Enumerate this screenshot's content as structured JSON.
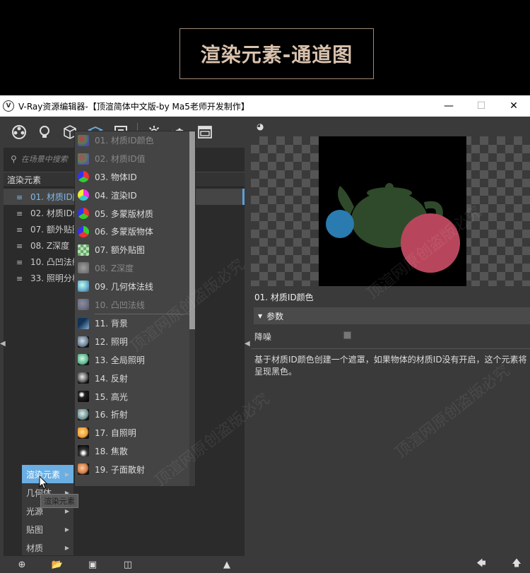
{
  "banner": {
    "title": "渲染元素-通道图"
  },
  "window": {
    "title": "V-Ray资源编辑器-【顶渲简体中文版-by Ma5老师开发制作】"
  },
  "search": {
    "placeholder": "在场景中搜索"
  },
  "tree": {
    "header": "渲染元素",
    "items": [
      {
        "label": "01. 材质ID颜色",
        "selected": true
      },
      {
        "label": "02. 材质ID值"
      },
      {
        "label": "07. 额外贴图"
      },
      {
        "label": "08. Z深度"
      },
      {
        "label": "10. 凸凹法线"
      },
      {
        "label": "33. 照明分析"
      }
    ]
  },
  "context_menu": {
    "items": [
      {
        "label": "渲染元素",
        "active": true
      },
      {
        "label": "几何体"
      },
      {
        "label": "光源"
      },
      {
        "label": "贴图"
      },
      {
        "label": "材质"
      }
    ],
    "tooltip": "渲染元素"
  },
  "submenu": {
    "group1": [
      {
        "label": "01. 材质ID颜色",
        "disabled": true,
        "icon": "swatch-multicolor"
      },
      {
        "label": "02. 材质ID值",
        "disabled": true,
        "icon": "swatch-multicolor"
      },
      {
        "label": "03. 物体ID",
        "icon": "swatch-rgb"
      },
      {
        "label": "04. 渲染ID",
        "icon": "swatch-rgb"
      },
      {
        "label": "05. 多蒙版材质",
        "icon": "swatch-rgb"
      },
      {
        "label": "06. 多蒙版物体",
        "icon": "swatch-rgb"
      },
      {
        "label": "07. 额外贴图",
        "icon": "swatch-checker"
      },
      {
        "label": "08. Z深度",
        "disabled": true,
        "icon": "swatch-gray"
      },
      {
        "label": "09. 几何体法线",
        "icon": "swatch-normal"
      },
      {
        "label": "10. 凸凹法线",
        "disabled": true,
        "icon": "swatch-normal"
      }
    ],
    "group2": [
      {
        "label": "11. 背景",
        "icon": "swatch-background"
      },
      {
        "label": "12. 照明",
        "icon": "swatch-sphere"
      },
      {
        "label": "13. 全局照明",
        "icon": "swatch-sphere"
      },
      {
        "label": "14. 反射",
        "icon": "swatch-sphere"
      },
      {
        "label": "15. 高光",
        "icon": "swatch-dark-sphere"
      },
      {
        "label": "16. 折射",
        "icon": "swatch-sphere"
      },
      {
        "label": "17. 自照明",
        "icon": "swatch-orange-sphere"
      },
      {
        "label": "18. 焦散",
        "icon": "swatch-dark-sphere"
      },
      {
        "label": "19. 子面散射",
        "icon": "swatch-orange-sphere"
      }
    ]
  },
  "properties": {
    "title": "01. 材质ID颜色",
    "section": "参数",
    "noise_label": "降噪",
    "description": "基于材质ID颜色创建一个遮罩，如果物体的材质ID没有开启，这个元素将呈现黑色。"
  },
  "watermark": "顶渲网原创盗版必究",
  "colors": {
    "accent": "#6aaee3",
    "selected_text": "#7fb8e6",
    "preview_blue": "#2a7bb0",
    "preview_red": "#b7465c",
    "preview_green": "#2f4a2a"
  }
}
